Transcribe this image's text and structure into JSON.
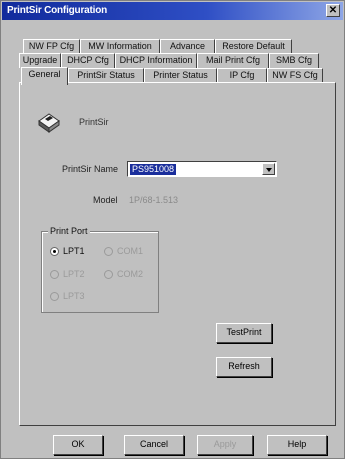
{
  "window": {
    "title": "PrintSir Configuration",
    "close_glyph": "✕"
  },
  "tabs": {
    "row1": [
      "NW FP Cfg",
      "MW Information",
      "Advance",
      "Restore Default"
    ],
    "row2": [
      "Upgrade",
      "DHCP Cfg",
      "DHCP Information",
      "Mail Print Cfg",
      "SMB Cfg"
    ],
    "row3": [
      "General",
      "PrintSir Status",
      "Printer Status",
      "IP Cfg",
      "NW FS Cfg"
    ],
    "active": "General"
  },
  "general": {
    "device_label": "PrintSir",
    "name_label": "PrintSir Name",
    "name_value": "PS951008",
    "model_label": "Model",
    "model_value": "1P/68-1.513",
    "print_port": {
      "legend": "Print Port",
      "options": [
        {
          "label": "LPT1",
          "checked": true,
          "enabled": true
        },
        {
          "label": "COM1",
          "checked": false,
          "enabled": false
        },
        {
          "label": "LPT2",
          "checked": false,
          "enabled": false
        },
        {
          "label": "COM2",
          "checked": false,
          "enabled": false
        },
        {
          "label": "LPT3",
          "checked": false,
          "enabled": false
        }
      ]
    },
    "test_print_label": "TestPrint",
    "refresh_label": "Refresh"
  },
  "footer": {
    "ok": "OK",
    "cancel": "Cancel",
    "apply": "Apply",
    "help": "Help"
  },
  "icons": {
    "printer": "printer-icon",
    "dropdown": "chevron-down-icon",
    "close": "close-icon"
  },
  "colors": {
    "title_start": "#102a9c",
    "title_end": "#8ea6e6",
    "selection": "#1a2e9c",
    "face": "#c0c0c0"
  }
}
